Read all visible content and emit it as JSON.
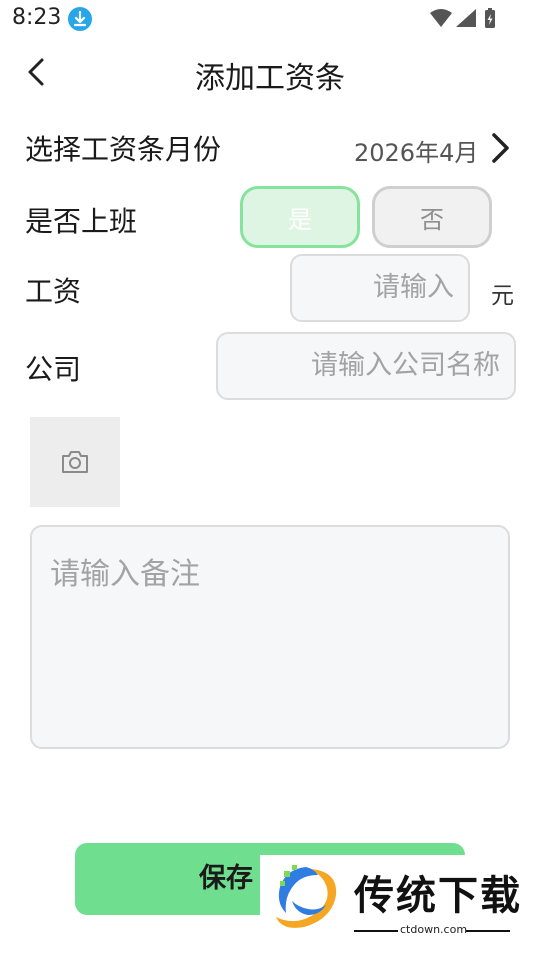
{
  "status_bar": {
    "time": "8:23"
  },
  "header": {
    "title": "添加工资条"
  },
  "form": {
    "month_label": "选择工资条月份",
    "month_value": "2026年4月",
    "work_label": "是否上班",
    "work_yes": "是",
    "work_no": "否",
    "work_selected": "是",
    "salary_label": "工资",
    "salary_placeholder": "请输入",
    "salary_unit": "元",
    "company_label": "公司",
    "company_placeholder": "请输入公司名称",
    "note_placeholder": "请输入备注"
  },
  "footer": {
    "save_label": "保存"
  },
  "watermark": {
    "brand": "传统下载",
    "url": "ctdown.com"
  },
  "colors": {
    "accent": "#6fdf8f",
    "toggle_active_border": "#86e39c",
    "toggle_active_bg": "#dff5e3",
    "download_badge": "#29a6e8"
  },
  "icons": [
    "download-icon",
    "wifi-icon",
    "signal-icon",
    "battery-icon",
    "back-icon",
    "chevron-right-icon",
    "camera-icon"
  ]
}
